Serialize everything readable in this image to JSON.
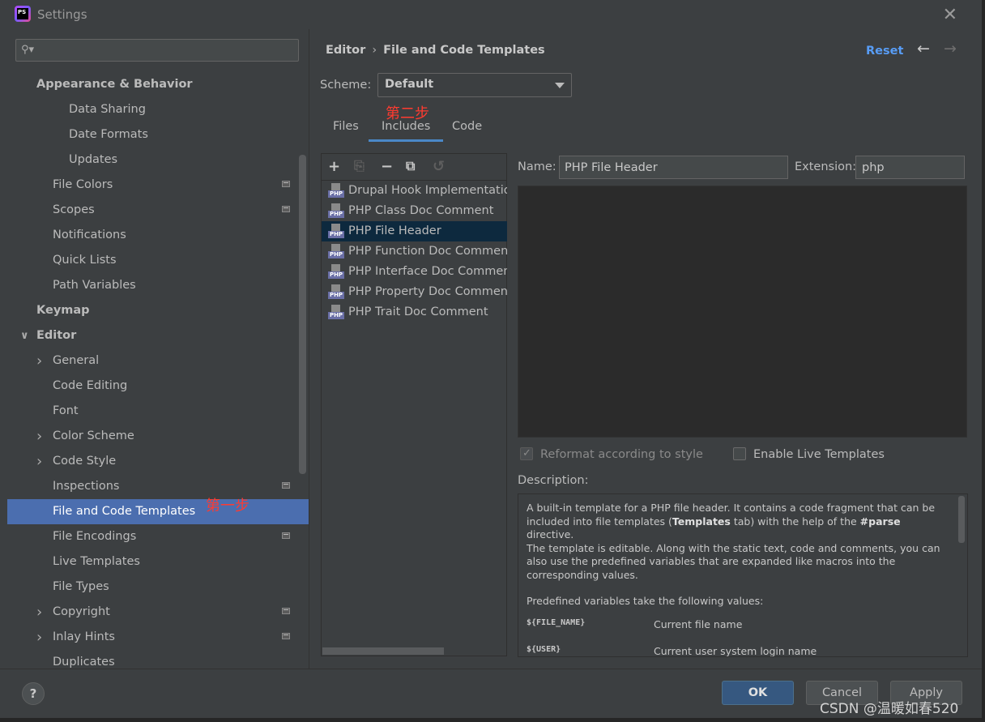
{
  "window": {
    "title": "Settings",
    "app_icon_text": "PS"
  },
  "search": {
    "placeholder": "",
    "value": ""
  },
  "sidebar": {
    "items": [
      {
        "label": "Appearance & Behavior",
        "indent": 0,
        "bold": true,
        "arrow": ""
      },
      {
        "label": "Data Sharing",
        "indent": 2,
        "bold": false,
        "arrow": ""
      },
      {
        "label": "Date Formats",
        "indent": 2,
        "bold": false,
        "arrow": ""
      },
      {
        "label": "Updates",
        "indent": 2,
        "bold": false,
        "arrow": ""
      },
      {
        "label": "File Colors",
        "indent": 1,
        "bold": false,
        "arrow": "",
        "project_icon": true
      },
      {
        "label": "Scopes",
        "indent": 1,
        "bold": false,
        "arrow": "",
        "project_icon": true
      },
      {
        "label": "Notifications",
        "indent": 1,
        "bold": false,
        "arrow": ""
      },
      {
        "label": "Quick Lists",
        "indent": 1,
        "bold": false,
        "arrow": ""
      },
      {
        "label": "Path Variables",
        "indent": 1,
        "bold": false,
        "arrow": ""
      },
      {
        "label": "Keymap",
        "indent": 0,
        "bold": true,
        "arrow": ""
      },
      {
        "label": "Editor",
        "indent": 0,
        "bold": true,
        "arrow": "down"
      },
      {
        "label": "General",
        "indent": 1,
        "bold": false,
        "arrow": "right"
      },
      {
        "label": "Code Editing",
        "indent": 1,
        "bold": false,
        "arrow": ""
      },
      {
        "label": "Font",
        "indent": 1,
        "bold": false,
        "arrow": ""
      },
      {
        "label": "Color Scheme",
        "indent": 1,
        "bold": false,
        "arrow": "right"
      },
      {
        "label": "Code Style",
        "indent": 1,
        "bold": false,
        "arrow": "right"
      },
      {
        "label": "Inspections",
        "indent": 1,
        "bold": false,
        "arrow": "",
        "project_icon": true
      },
      {
        "label": "File and Code Templates",
        "indent": 1,
        "bold": false,
        "arrow": "",
        "selected": true
      },
      {
        "label": "File Encodings",
        "indent": 1,
        "bold": false,
        "arrow": "",
        "project_icon": true
      },
      {
        "label": "Live Templates",
        "indent": 1,
        "bold": false,
        "arrow": ""
      },
      {
        "label": "File Types",
        "indent": 1,
        "bold": false,
        "arrow": ""
      },
      {
        "label": "Copyright",
        "indent": 1,
        "bold": false,
        "arrow": "right",
        "project_icon": true
      },
      {
        "label": "Inlay Hints",
        "indent": 1,
        "bold": false,
        "arrow": "right",
        "project_icon": true
      },
      {
        "label": "Duplicates",
        "indent": 1,
        "bold": false,
        "arrow": ""
      }
    ]
  },
  "annotations": {
    "step1": "第一步",
    "step2": "第二步"
  },
  "header": {
    "breadcrumb": [
      "Editor",
      "File and Code Templates"
    ],
    "reset_label": "Reset",
    "back_icon": "arrow-left-icon",
    "forward_icon": "arrow-right-icon"
  },
  "scheme": {
    "label": "Scheme:",
    "value": "Default"
  },
  "tabs": [
    {
      "label": "Files",
      "active": false
    },
    {
      "label": "Includes",
      "active": true
    },
    {
      "label": "Code",
      "active": false
    }
  ],
  "toolbar": {
    "icons": [
      "add-icon",
      "copy-template-icon",
      "remove-icon",
      "duplicate-icon",
      "reset-icon"
    ]
  },
  "templates": [
    {
      "label": "Drupal Hook Implementation",
      "icon_text": "PHP",
      "selected": false
    },
    {
      "label": "PHP Class Doc Comment",
      "icon_text": "PHP",
      "selected": false
    },
    {
      "label": "PHP File Header",
      "icon_text": "PHP",
      "selected": true
    },
    {
      "label": "PHP Function Doc Comment",
      "icon_text": "PHP",
      "selected": false
    },
    {
      "label": "PHP Interface Doc Comment",
      "icon_text": "PHP",
      "selected": false
    },
    {
      "label": "PHP Property Doc Comment",
      "icon_text": "PHP",
      "selected": false
    },
    {
      "label": "PHP Trait Doc Comment",
      "icon_text": "PHP",
      "selected": false
    }
  ],
  "editor": {
    "name_label": "Name:",
    "name_value": "PHP File Header",
    "extension_label": "Extension:",
    "extension_value": "php",
    "content": "",
    "reformat_label": "Reformat according to style",
    "reformat_checked": true,
    "live_templates_label": "Enable Live Templates",
    "live_templates_checked": false
  },
  "description": {
    "label": "Description:",
    "p1_a": "A built-in template for a PHP file header. It contains a code fragment that can be included into file templates (",
    "p1_bold": "Templates",
    "p1_b": " tab) with the help of the ",
    "p1_bold2": "#parse",
    "p1_c": " directive.",
    "p2": "The template is editable. Along with the static text, code and comments, you can also use the predefined variables that are expanded like macros into the corresponding values.",
    "p3": "Predefined variables take the following values:",
    "vars": [
      {
        "name": "${FILE_NAME}",
        "desc": "Current file name"
      },
      {
        "name": "${USER}",
        "desc": "Current user system login name"
      }
    ]
  },
  "footer": {
    "help_label": "?",
    "ok_label": "OK",
    "cancel_label": "Cancel",
    "apply_label": "Apply"
  },
  "watermark": "CSDN @温暖如春520",
  "colors": {
    "selection": "#4b6eaf",
    "list_selection": "#0d293e",
    "link": "#589df6",
    "annotation": "#ff3b30",
    "ok_button": "#365880"
  }
}
